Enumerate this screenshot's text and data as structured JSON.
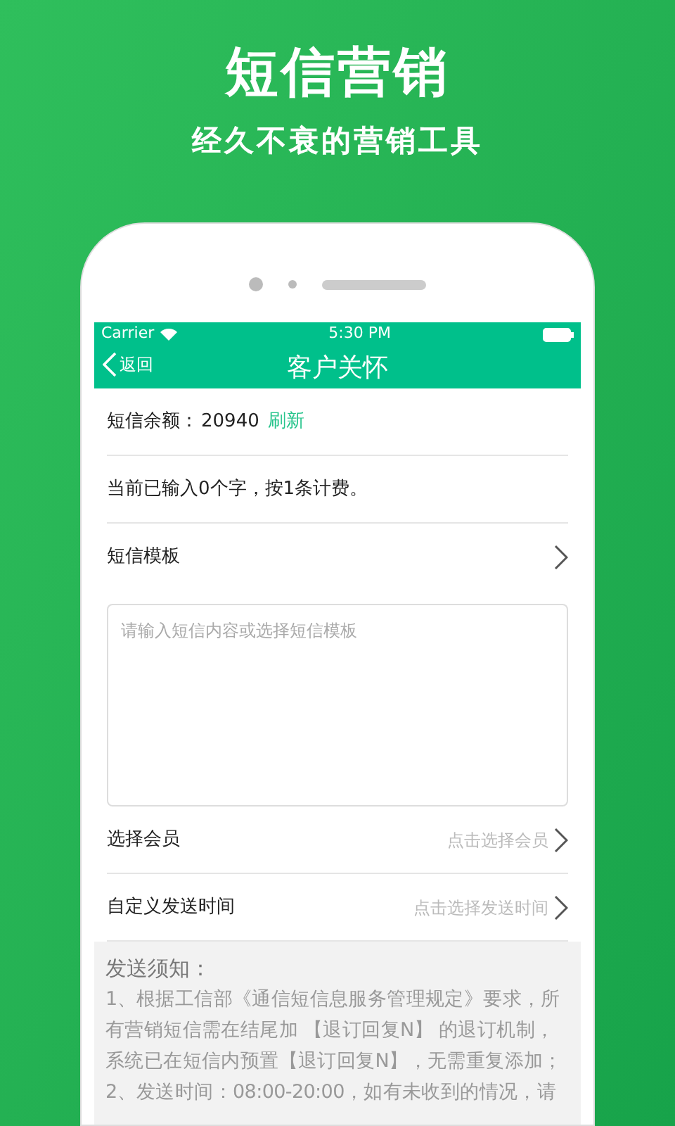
{
  "banner": {
    "title": "短信营销",
    "subtitle": "经久不衰的营销工具"
  },
  "status_bar": {
    "carrier": "Carrier",
    "time": "5:30 PM"
  },
  "nav": {
    "back": "返回",
    "title": "客户关怀"
  },
  "balance": {
    "label": "短信余额：",
    "value": "20940",
    "action": "刷新"
  },
  "count_text": "当前已输入0个字，按1条计费。",
  "template": {
    "label": "短信模板"
  },
  "message": {
    "placeholder": "请输入短信内容或选择短信模板"
  },
  "pickers": [
    {
      "label": "选择会员",
      "hint": "点击选择会员"
    },
    {
      "label": "自定义发送时间",
      "hint": "点击选择发送时间"
    }
  ],
  "notice": {
    "title": "发送须知：",
    "lines": [
      "1、根据工信部《通信短信息服务管理规定》要求，所",
      "有营销短信需在结尾加 【退订回复N】 的退订机制，",
      "系统已在短信内预置【退订回复N】，无需重复添加；",
      "2、发送时间：08:00-20:00，如有未收到的情况，请"
    ]
  }
}
